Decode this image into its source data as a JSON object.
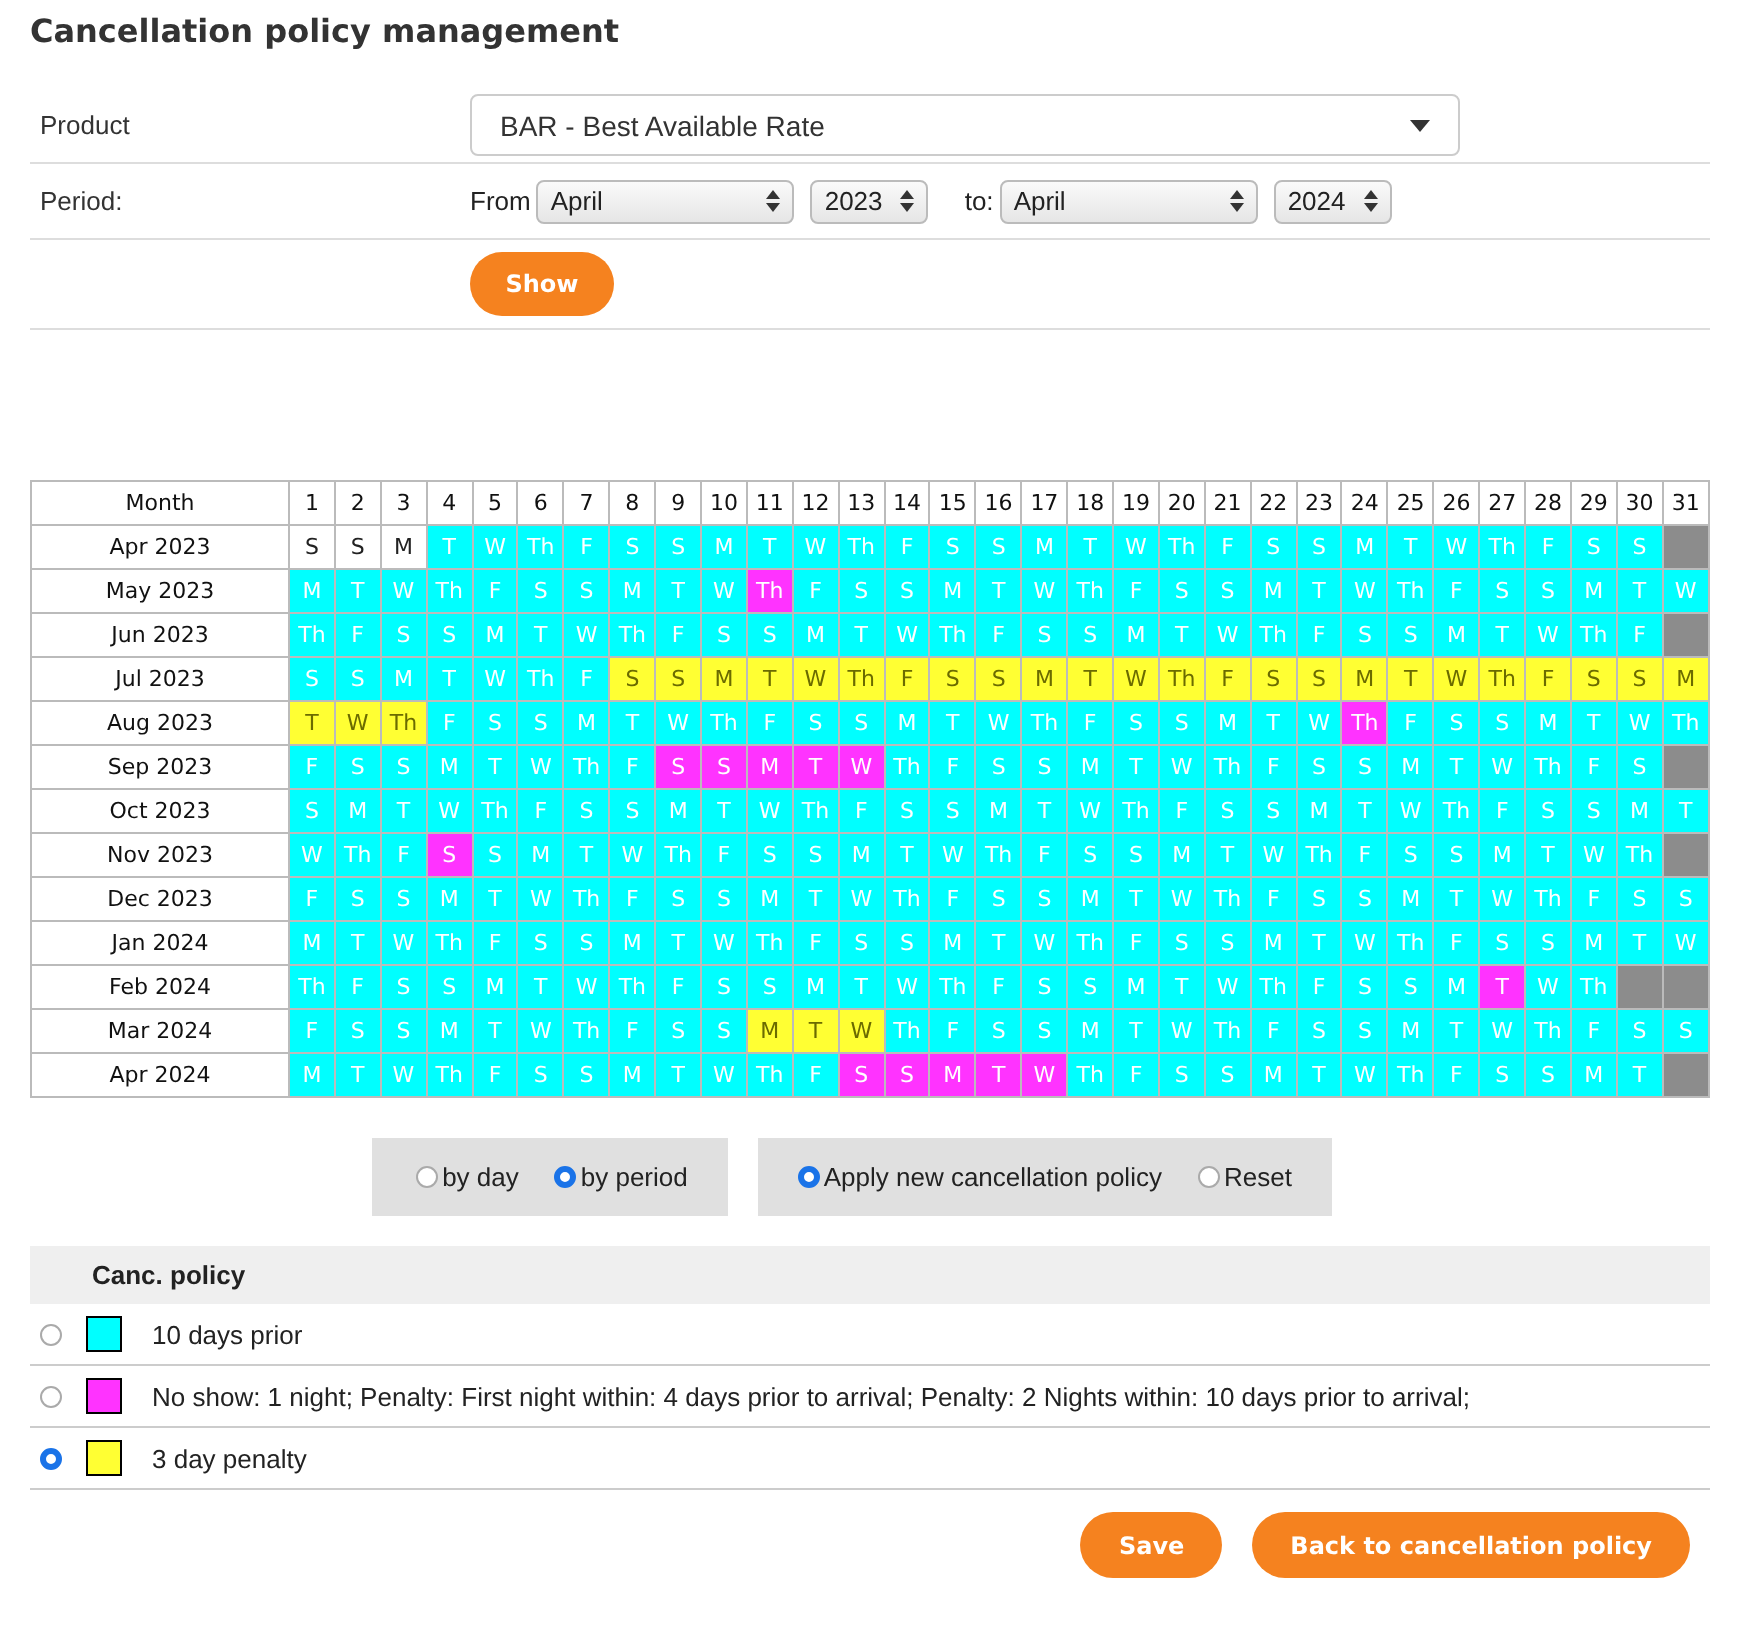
{
  "page_title": "Cancellation policy management",
  "form": {
    "product": {
      "label": "Product",
      "value": "BAR - Best Available Rate"
    },
    "period": {
      "label": "Period:",
      "from_label": "From",
      "from_month": "April",
      "from_year": "2023",
      "to_label": "to:",
      "to_month": "April",
      "to_year": "2024"
    },
    "show_button": "Show"
  },
  "calendar": {
    "month_header": "Month",
    "day_numbers": [
      "1",
      "2",
      "3",
      "4",
      "5",
      "6",
      "7",
      "8",
      "9",
      "10",
      "11",
      "12",
      "13",
      "14",
      "15",
      "16",
      "17",
      "18",
      "19",
      "20",
      "21",
      "22",
      "23",
      "24",
      "25",
      "26",
      "27",
      "28",
      "29",
      "30",
      "31"
    ],
    "rows": [
      {
        "month": "Apr 2023",
        "days": [
          {
            "day": "S",
            "color": "#ffffff"
          },
          {
            "day": "S",
            "color": "#ffffff"
          },
          {
            "day": "M",
            "color": "#ffffff"
          },
          {
            "day": "T",
            "color": "#00ffff"
          },
          {
            "day": "W",
            "color": "#00ffff"
          },
          {
            "day": "Th",
            "color": "#00ffff"
          },
          {
            "day": "F",
            "color": "#00ffff"
          },
          {
            "day": "S",
            "color": "#00ffff"
          },
          {
            "day": "S",
            "color": "#00ffff"
          },
          {
            "day": "M",
            "color": "#00ffff"
          },
          {
            "day": "T",
            "color": "#00ffff"
          },
          {
            "day": "W",
            "color": "#00ffff"
          },
          {
            "day": "Th",
            "color": "#00ffff"
          },
          {
            "day": "F",
            "color": "#00ffff"
          },
          {
            "day": "S",
            "color": "#00ffff"
          },
          {
            "day": "S",
            "color": "#00ffff"
          },
          {
            "day": "M",
            "color": "#00ffff"
          },
          {
            "day": "T",
            "color": "#00ffff"
          },
          {
            "day": "W",
            "color": "#00ffff"
          },
          {
            "day": "Th",
            "color": "#00ffff"
          },
          {
            "day": "F",
            "color": "#00ffff"
          },
          {
            "day": "S",
            "color": "#00ffff"
          },
          {
            "day": "S",
            "color": "#00ffff"
          },
          {
            "day": "M",
            "color": "#00ffff"
          },
          {
            "day": "T",
            "color": "#00ffff"
          },
          {
            "day": "W",
            "color": "#00ffff"
          },
          {
            "day": "Th",
            "color": "#00ffff"
          },
          {
            "day": "F",
            "color": "#00ffff"
          },
          {
            "day": "S",
            "color": "#00ffff"
          },
          {
            "day": "S",
            "color": "#00ffff"
          },
          {
            "color": "#8c8c8c"
          }
        ]
      },
      {
        "month": "May 2023",
        "days": [
          {
            "day": "M",
            "color": "#00ffff"
          },
          {
            "day": "T",
            "color": "#00ffff"
          },
          {
            "day": "W",
            "color": "#00ffff"
          },
          {
            "day": "Th",
            "color": "#00ffff"
          },
          {
            "day": "F",
            "color": "#00ffff"
          },
          {
            "day": "S",
            "color": "#00ffff"
          },
          {
            "day": "S",
            "color": "#00ffff"
          },
          {
            "day": "M",
            "color": "#00ffff"
          },
          {
            "day": "T",
            "color": "#00ffff"
          },
          {
            "day": "W",
            "color": "#00ffff"
          },
          {
            "day": "Th",
            "color": "#ff33ff"
          },
          {
            "day": "F",
            "color": "#00ffff"
          },
          {
            "day": "S",
            "color": "#00ffff"
          },
          {
            "day": "S",
            "color": "#00ffff"
          },
          {
            "day": "M",
            "color": "#00ffff"
          },
          {
            "day": "T",
            "color": "#00ffff"
          },
          {
            "day": "W",
            "color": "#00ffff"
          },
          {
            "day": "Th",
            "color": "#00ffff"
          },
          {
            "day": "F",
            "color": "#00ffff"
          },
          {
            "day": "S",
            "color": "#00ffff"
          },
          {
            "day": "S",
            "color": "#00ffff"
          },
          {
            "day": "M",
            "color": "#00ffff"
          },
          {
            "day": "T",
            "color": "#00ffff"
          },
          {
            "day": "W",
            "color": "#00ffff"
          },
          {
            "day": "Th",
            "color": "#00ffff"
          },
          {
            "day": "F",
            "color": "#00ffff"
          },
          {
            "day": "S",
            "color": "#00ffff"
          },
          {
            "day": "S",
            "color": "#00ffff"
          },
          {
            "day": "M",
            "color": "#00ffff"
          },
          {
            "day": "T",
            "color": "#00ffff"
          },
          {
            "day": "W",
            "color": "#00ffff"
          }
        ]
      },
      {
        "month": "Jun 2023",
        "days": [
          {
            "day": "Th",
            "color": "#00ffff"
          },
          {
            "day": "F",
            "color": "#00ffff"
          },
          {
            "day": "S",
            "color": "#00ffff"
          },
          {
            "day": "S",
            "color": "#00ffff"
          },
          {
            "day": "M",
            "color": "#00ffff"
          },
          {
            "day": "T",
            "color": "#00ffff"
          },
          {
            "day": "W",
            "color": "#00ffff"
          },
          {
            "day": "Th",
            "color": "#00ffff"
          },
          {
            "day": "F",
            "color": "#00ffff"
          },
          {
            "day": "S",
            "color": "#00ffff"
          },
          {
            "day": "S",
            "color": "#00ffff"
          },
          {
            "day": "M",
            "color": "#00ffff"
          },
          {
            "day": "T",
            "color": "#00ffff"
          },
          {
            "day": "W",
            "color": "#00ffff"
          },
          {
            "day": "Th",
            "color": "#00ffff"
          },
          {
            "day": "F",
            "color": "#00ffff"
          },
          {
            "day": "S",
            "color": "#00ffff"
          },
          {
            "day": "S",
            "color": "#00ffff"
          },
          {
            "day": "M",
            "color": "#00ffff"
          },
          {
            "day": "T",
            "color": "#00ffff"
          },
          {
            "day": "W",
            "color": "#00ffff"
          },
          {
            "day": "Th",
            "color": "#00ffff"
          },
          {
            "day": "F",
            "color": "#00ffff"
          },
          {
            "day": "S",
            "color": "#00ffff"
          },
          {
            "day": "S",
            "color": "#00ffff"
          },
          {
            "day": "M",
            "color": "#00ffff"
          },
          {
            "day": "T",
            "color": "#00ffff"
          },
          {
            "day": "W",
            "color": "#00ffff"
          },
          {
            "day": "Th",
            "color": "#00ffff"
          },
          {
            "day": "F",
            "color": "#00ffff"
          },
          {
            "color": "#8c8c8c"
          }
        ]
      },
      {
        "month": "Jul 2023",
        "days": [
          {
            "day": "S",
            "color": "#00ffff"
          },
          {
            "day": "S",
            "color": "#00ffff"
          },
          {
            "day": "M",
            "color": "#00ffff"
          },
          {
            "day": "T",
            "color": "#00ffff"
          },
          {
            "day": "W",
            "color": "#00ffff"
          },
          {
            "day": "Th",
            "color": "#00ffff"
          },
          {
            "day": "F",
            "color": "#00ffff"
          },
          {
            "day": "S",
            "color": "#ffff33"
          },
          {
            "day": "S",
            "color": "#ffff33"
          },
          {
            "day": "M",
            "color": "#ffff33"
          },
          {
            "day": "T",
            "color": "#ffff33"
          },
          {
            "day": "W",
            "color": "#ffff33"
          },
          {
            "day": "Th",
            "color": "#ffff33"
          },
          {
            "day": "F",
            "color": "#ffff33"
          },
          {
            "day": "S",
            "color": "#ffff33"
          },
          {
            "day": "S",
            "color": "#ffff33"
          },
          {
            "day": "M",
            "color": "#ffff33"
          },
          {
            "day": "T",
            "color": "#ffff33"
          },
          {
            "day": "W",
            "color": "#ffff33"
          },
          {
            "day": "Th",
            "color": "#ffff33"
          },
          {
            "day": "F",
            "color": "#ffff33"
          },
          {
            "day": "S",
            "color": "#ffff33"
          },
          {
            "day": "S",
            "color": "#ffff33"
          },
          {
            "day": "M",
            "color": "#ffff33"
          },
          {
            "day": "T",
            "color": "#ffff33"
          },
          {
            "day": "W",
            "color": "#ffff33"
          },
          {
            "day": "Th",
            "color": "#ffff33"
          },
          {
            "day": "F",
            "color": "#ffff33"
          },
          {
            "day": "S",
            "color": "#ffff33"
          },
          {
            "day": "S",
            "color": "#ffff33"
          },
          {
            "day": "M",
            "color": "#ffff33"
          }
        ]
      },
      {
        "month": "Aug 2023",
        "days": [
          {
            "day": "T",
            "color": "#ffff33"
          },
          {
            "day": "W",
            "color": "#ffff33"
          },
          {
            "day": "Th",
            "color": "#ffff33"
          },
          {
            "day": "F",
            "color": "#00ffff"
          },
          {
            "day": "S",
            "color": "#00ffff"
          },
          {
            "day": "S",
            "color": "#00ffff"
          },
          {
            "day": "M",
            "color": "#00ffff"
          },
          {
            "day": "T",
            "color": "#00ffff"
          },
          {
            "day": "W",
            "color": "#00ffff"
          },
          {
            "day": "Th",
            "color": "#00ffff"
          },
          {
            "day": "F",
            "color": "#00ffff"
          },
          {
            "day": "S",
            "color": "#00ffff"
          },
          {
            "day": "S",
            "color": "#00ffff"
          },
          {
            "day": "M",
            "color": "#00ffff"
          },
          {
            "day": "T",
            "color": "#00ffff"
          },
          {
            "day": "W",
            "color": "#00ffff"
          },
          {
            "day": "Th",
            "color": "#00ffff"
          },
          {
            "day": "F",
            "color": "#00ffff"
          },
          {
            "day": "S",
            "color": "#00ffff"
          },
          {
            "day": "S",
            "color": "#00ffff"
          },
          {
            "day": "M",
            "color": "#00ffff"
          },
          {
            "day": "T",
            "color": "#00ffff"
          },
          {
            "day": "W",
            "color": "#00ffff"
          },
          {
            "day": "Th",
            "color": "#ff33ff"
          },
          {
            "day": "F",
            "color": "#00ffff"
          },
          {
            "day": "S",
            "color": "#00ffff"
          },
          {
            "day": "S",
            "color": "#00ffff"
          },
          {
            "day": "M",
            "color": "#00ffff"
          },
          {
            "day": "T",
            "color": "#00ffff"
          },
          {
            "day": "W",
            "color": "#00ffff"
          },
          {
            "day": "Th",
            "color": "#00ffff"
          }
        ]
      },
      {
        "month": "Sep 2023",
        "days": [
          {
            "day": "F",
            "color": "#00ffff"
          },
          {
            "day": "S",
            "color": "#00ffff"
          },
          {
            "day": "S",
            "color": "#00ffff"
          },
          {
            "day": "M",
            "color": "#00ffff"
          },
          {
            "day": "T",
            "color": "#00ffff"
          },
          {
            "day": "W",
            "color": "#00ffff"
          },
          {
            "day": "Th",
            "color": "#00ffff"
          },
          {
            "day": "F",
            "color": "#00ffff"
          },
          {
            "day": "S",
            "color": "#ff33ff"
          },
          {
            "day": "S",
            "color": "#ff33ff"
          },
          {
            "day": "M",
            "color": "#ff33ff"
          },
          {
            "day": "T",
            "color": "#ff33ff"
          },
          {
            "day": "W",
            "color": "#ff33ff"
          },
          {
            "day": "Th",
            "color": "#00ffff"
          },
          {
            "day": "F",
            "color": "#00ffff"
          },
          {
            "day": "S",
            "color": "#00ffff"
          },
          {
            "day": "S",
            "color": "#00ffff"
          },
          {
            "day": "M",
            "color": "#00ffff"
          },
          {
            "day": "T",
            "color": "#00ffff"
          },
          {
            "day": "W",
            "color": "#00ffff"
          },
          {
            "day": "Th",
            "color": "#00ffff"
          },
          {
            "day": "F",
            "color": "#00ffff"
          },
          {
            "day": "S",
            "color": "#00ffff"
          },
          {
            "day": "S",
            "color": "#00ffff"
          },
          {
            "day": "M",
            "color": "#00ffff"
          },
          {
            "day": "T",
            "color": "#00ffff"
          },
          {
            "day": "W",
            "color": "#00ffff"
          },
          {
            "day": "Th",
            "color": "#00ffff"
          },
          {
            "day": "F",
            "color": "#00ffff"
          },
          {
            "day": "S",
            "color": "#00ffff"
          },
          {
            "color": "#8c8c8c"
          }
        ]
      },
      {
        "month": "Oct 2023",
        "days": [
          {
            "day": "S",
            "color": "#00ffff"
          },
          {
            "day": "M",
            "color": "#00ffff"
          },
          {
            "day": "T",
            "color": "#00ffff"
          },
          {
            "day": "W",
            "color": "#00ffff"
          },
          {
            "day": "Th",
            "color": "#00ffff"
          },
          {
            "day": "F",
            "color": "#00ffff"
          },
          {
            "day": "S",
            "color": "#00ffff"
          },
          {
            "day": "S",
            "color": "#00ffff"
          },
          {
            "day": "M",
            "color": "#00ffff"
          },
          {
            "day": "T",
            "color": "#00ffff"
          },
          {
            "day": "W",
            "color": "#00ffff"
          },
          {
            "day": "Th",
            "color": "#00ffff"
          },
          {
            "day": "F",
            "color": "#00ffff"
          },
          {
            "day": "S",
            "color": "#00ffff"
          },
          {
            "day": "S",
            "color": "#00ffff"
          },
          {
            "day": "M",
            "color": "#00ffff"
          },
          {
            "day": "T",
            "color": "#00ffff"
          },
          {
            "day": "W",
            "color": "#00ffff"
          },
          {
            "day": "Th",
            "color": "#00ffff"
          },
          {
            "day": "F",
            "color": "#00ffff"
          },
          {
            "day": "S",
            "color": "#00ffff"
          },
          {
            "day": "S",
            "color": "#00ffff"
          },
          {
            "day": "M",
            "color": "#00ffff"
          },
          {
            "day": "T",
            "color": "#00ffff"
          },
          {
            "day": "W",
            "color": "#00ffff"
          },
          {
            "day": "Th",
            "color": "#00ffff"
          },
          {
            "day": "F",
            "color": "#00ffff"
          },
          {
            "day": "S",
            "color": "#00ffff"
          },
          {
            "day": "S",
            "color": "#00ffff"
          },
          {
            "day": "M",
            "color": "#00ffff"
          },
          {
            "day": "T",
            "color": "#00ffff"
          }
        ]
      },
      {
        "month": "Nov 2023",
        "days": [
          {
            "day": "W",
            "color": "#00ffff"
          },
          {
            "day": "Th",
            "color": "#00ffff"
          },
          {
            "day": "F",
            "color": "#00ffff"
          },
          {
            "day": "S",
            "color": "#ff33ff"
          },
          {
            "day": "S",
            "color": "#00ffff"
          },
          {
            "day": "M",
            "color": "#00ffff"
          },
          {
            "day": "T",
            "color": "#00ffff"
          },
          {
            "day": "W",
            "color": "#00ffff"
          },
          {
            "day": "Th",
            "color": "#00ffff"
          },
          {
            "day": "F",
            "color": "#00ffff"
          },
          {
            "day": "S",
            "color": "#00ffff"
          },
          {
            "day": "S",
            "color": "#00ffff"
          },
          {
            "day": "M",
            "color": "#00ffff"
          },
          {
            "day": "T",
            "color": "#00ffff"
          },
          {
            "day": "W",
            "color": "#00ffff"
          },
          {
            "day": "Th",
            "color": "#00ffff"
          },
          {
            "day": "F",
            "color": "#00ffff"
          },
          {
            "day": "S",
            "color": "#00ffff"
          },
          {
            "day": "S",
            "color": "#00ffff"
          },
          {
            "day": "M",
            "color": "#00ffff"
          },
          {
            "day": "T",
            "color": "#00ffff"
          },
          {
            "day": "W",
            "color": "#00ffff"
          },
          {
            "day": "Th",
            "color": "#00ffff"
          },
          {
            "day": "F",
            "color": "#00ffff"
          },
          {
            "day": "S",
            "color": "#00ffff"
          },
          {
            "day": "S",
            "color": "#00ffff"
          },
          {
            "day": "M",
            "color": "#00ffff"
          },
          {
            "day": "T",
            "color": "#00ffff"
          },
          {
            "day": "W",
            "color": "#00ffff"
          },
          {
            "day": "Th",
            "color": "#00ffff"
          },
          {
            "color": "#8c8c8c"
          }
        ]
      },
      {
        "month": "Dec 2023",
        "days": [
          {
            "day": "F",
            "color": "#00ffff"
          },
          {
            "day": "S",
            "color": "#00ffff"
          },
          {
            "day": "S",
            "color": "#00ffff"
          },
          {
            "day": "M",
            "color": "#00ffff"
          },
          {
            "day": "T",
            "color": "#00ffff"
          },
          {
            "day": "W",
            "color": "#00ffff"
          },
          {
            "day": "Th",
            "color": "#00ffff"
          },
          {
            "day": "F",
            "color": "#00ffff"
          },
          {
            "day": "S",
            "color": "#00ffff"
          },
          {
            "day": "S",
            "color": "#00ffff"
          },
          {
            "day": "M",
            "color": "#00ffff"
          },
          {
            "day": "T",
            "color": "#00ffff"
          },
          {
            "day": "W",
            "color": "#00ffff"
          },
          {
            "day": "Th",
            "color": "#00ffff"
          },
          {
            "day": "F",
            "color": "#00ffff"
          },
          {
            "day": "S",
            "color": "#00ffff"
          },
          {
            "day": "S",
            "color": "#00ffff"
          },
          {
            "day": "M",
            "color": "#00ffff"
          },
          {
            "day": "T",
            "color": "#00ffff"
          },
          {
            "day": "W",
            "color": "#00ffff"
          },
          {
            "day": "Th",
            "color": "#00ffff"
          },
          {
            "day": "F",
            "color": "#00ffff"
          },
          {
            "day": "S",
            "color": "#00ffff"
          },
          {
            "day": "S",
            "color": "#00ffff"
          },
          {
            "day": "M",
            "color": "#00ffff"
          },
          {
            "day": "T",
            "color": "#00ffff"
          },
          {
            "day": "W",
            "color": "#00ffff"
          },
          {
            "day": "Th",
            "color": "#00ffff"
          },
          {
            "day": "F",
            "color": "#00ffff"
          },
          {
            "day": "S",
            "color": "#00ffff"
          },
          {
            "day": "S",
            "color": "#00ffff"
          }
        ]
      },
      {
        "month": "Jan 2024",
        "days": [
          {
            "day": "M",
            "color": "#00ffff"
          },
          {
            "day": "T",
            "color": "#00ffff"
          },
          {
            "day": "W",
            "color": "#00ffff"
          },
          {
            "day": "Th",
            "color": "#00ffff"
          },
          {
            "day": "F",
            "color": "#00ffff"
          },
          {
            "day": "S",
            "color": "#00ffff"
          },
          {
            "day": "S",
            "color": "#00ffff"
          },
          {
            "day": "M",
            "color": "#00ffff"
          },
          {
            "day": "T",
            "color": "#00ffff"
          },
          {
            "day": "W",
            "color": "#00ffff"
          },
          {
            "day": "Th",
            "color": "#00ffff"
          },
          {
            "day": "F",
            "color": "#00ffff"
          },
          {
            "day": "S",
            "color": "#00ffff"
          },
          {
            "day": "S",
            "color": "#00ffff"
          },
          {
            "day": "M",
            "color": "#00ffff"
          },
          {
            "day": "T",
            "color": "#00ffff"
          },
          {
            "day": "W",
            "color": "#00ffff"
          },
          {
            "day": "Th",
            "color": "#00ffff"
          },
          {
            "day": "F",
            "color": "#00ffff"
          },
          {
            "day": "S",
            "color": "#00ffff"
          },
          {
            "day": "S",
            "color": "#00ffff"
          },
          {
            "day": "M",
            "color": "#00ffff"
          },
          {
            "day": "T",
            "color": "#00ffff"
          },
          {
            "day": "W",
            "color": "#00ffff"
          },
          {
            "day": "Th",
            "color": "#00ffff"
          },
          {
            "day": "F",
            "color": "#00ffff"
          },
          {
            "day": "S",
            "color": "#00ffff"
          },
          {
            "day": "S",
            "color": "#00ffff"
          },
          {
            "day": "M",
            "color": "#00ffff"
          },
          {
            "day": "T",
            "color": "#00ffff"
          },
          {
            "day": "W",
            "color": "#00ffff"
          }
        ]
      },
      {
        "month": "Feb 2024",
        "days": [
          {
            "day": "Th",
            "color": "#00ffff"
          },
          {
            "day": "F",
            "color": "#00ffff"
          },
          {
            "day": "S",
            "color": "#00ffff"
          },
          {
            "day": "S",
            "color": "#00ffff"
          },
          {
            "day": "M",
            "color": "#00ffff"
          },
          {
            "day": "T",
            "color": "#00ffff"
          },
          {
            "day": "W",
            "color": "#00ffff"
          },
          {
            "day": "Th",
            "color": "#00ffff"
          },
          {
            "day": "F",
            "color": "#00ffff"
          },
          {
            "day": "S",
            "color": "#00ffff"
          },
          {
            "day": "S",
            "color": "#00ffff"
          },
          {
            "day": "M",
            "color": "#00ffff"
          },
          {
            "day": "T",
            "color": "#00ffff"
          },
          {
            "day": "W",
            "color": "#00ffff"
          },
          {
            "day": "Th",
            "color": "#00ffff"
          },
          {
            "day": "F",
            "color": "#00ffff"
          },
          {
            "day": "S",
            "color": "#00ffff"
          },
          {
            "day": "S",
            "color": "#00ffff"
          },
          {
            "day": "M",
            "color": "#00ffff"
          },
          {
            "day": "T",
            "color": "#00ffff"
          },
          {
            "day": "W",
            "color": "#00ffff"
          },
          {
            "day": "Th",
            "color": "#00ffff"
          },
          {
            "day": "F",
            "color": "#00ffff"
          },
          {
            "day": "S",
            "color": "#00ffff"
          },
          {
            "day": "S",
            "color": "#00ffff"
          },
          {
            "day": "M",
            "color": "#00ffff"
          },
          {
            "day": "T",
            "color": "#ff33ff"
          },
          {
            "day": "W",
            "color": "#00ffff"
          },
          {
            "day": "Th",
            "color": "#00ffff"
          },
          {
            "color": "#8c8c8c"
          },
          {
            "color": "#8c8c8c"
          }
        ]
      },
      {
        "month": "Mar 2024",
        "days": [
          {
            "day": "F",
            "color": "#00ffff"
          },
          {
            "day": "S",
            "color": "#00ffff"
          },
          {
            "day": "S",
            "color": "#00ffff"
          },
          {
            "day": "M",
            "color": "#00ffff"
          },
          {
            "day": "T",
            "color": "#00ffff"
          },
          {
            "day": "W",
            "color": "#00ffff"
          },
          {
            "day": "Th",
            "color": "#00ffff"
          },
          {
            "day": "F",
            "color": "#00ffff"
          },
          {
            "day": "S",
            "color": "#00ffff"
          },
          {
            "day": "S",
            "color": "#00ffff"
          },
          {
            "day": "M",
            "color": "#ffff33"
          },
          {
            "day": "T",
            "color": "#ffff33"
          },
          {
            "day": "W",
            "color": "#ffff33"
          },
          {
            "day": "Th",
            "color": "#00ffff"
          },
          {
            "day": "F",
            "color": "#00ffff"
          },
          {
            "day": "S",
            "color": "#00ffff"
          },
          {
            "day": "S",
            "color": "#00ffff"
          },
          {
            "day": "M",
            "color": "#00ffff"
          },
          {
            "day": "T",
            "color": "#00ffff"
          },
          {
            "day": "W",
            "color": "#00ffff"
          },
          {
            "day": "Th",
            "color": "#00ffff"
          },
          {
            "day": "F",
            "color": "#00ffff"
          },
          {
            "day": "S",
            "color": "#00ffff"
          },
          {
            "day": "S",
            "color": "#00ffff"
          },
          {
            "day": "M",
            "color": "#00ffff"
          },
          {
            "day": "T",
            "color": "#00ffff"
          },
          {
            "day": "W",
            "color": "#00ffff"
          },
          {
            "day": "Th",
            "color": "#00ffff"
          },
          {
            "day": "F",
            "color": "#00ffff"
          },
          {
            "day": "S",
            "color": "#00ffff"
          },
          {
            "day": "S",
            "color": "#00ffff"
          }
        ]
      },
      {
        "month": "Apr 2024",
        "days": [
          {
            "day": "M",
            "color": "#00ffff"
          },
          {
            "day": "T",
            "color": "#00ffff"
          },
          {
            "day": "W",
            "color": "#00ffff"
          },
          {
            "day": "Th",
            "color": "#00ffff"
          },
          {
            "day": "F",
            "color": "#00ffff"
          },
          {
            "day": "S",
            "color": "#00ffff"
          },
          {
            "day": "S",
            "color": "#00ffff"
          },
          {
            "day": "M",
            "color": "#00ffff"
          },
          {
            "day": "T",
            "color": "#00ffff"
          },
          {
            "day": "W",
            "color": "#00ffff"
          },
          {
            "day": "Th",
            "color": "#00ffff"
          },
          {
            "day": "F",
            "color": "#00ffff"
          },
          {
            "day": "S",
            "color": "#ff33ff"
          },
          {
            "day": "S",
            "color": "#ff33ff"
          },
          {
            "day": "M",
            "color": "#ff33ff"
          },
          {
            "day": "T",
            "color": "#ff33ff"
          },
          {
            "day": "W",
            "color": "#ff33ff"
          },
          {
            "day": "Th",
            "color": "#00ffff"
          },
          {
            "day": "F",
            "color": "#00ffff"
          },
          {
            "day": "S",
            "color": "#00ffff"
          },
          {
            "day": "S",
            "color": "#00ffff"
          },
          {
            "day": "M",
            "color": "#00ffff"
          },
          {
            "day": "T",
            "color": "#00ffff"
          },
          {
            "day": "W",
            "color": "#00ffff"
          },
          {
            "day": "Th",
            "color": "#00ffff"
          },
          {
            "day": "F",
            "color": "#00ffff"
          },
          {
            "day": "S",
            "color": "#00ffff"
          },
          {
            "day": "S",
            "color": "#00ffff"
          },
          {
            "day": "M",
            "color": "#00ffff"
          },
          {
            "day": "T",
            "color": "#00ffff"
          },
          {
            "color": "#8c8c8c"
          }
        ]
      }
    ]
  },
  "mode_options": [
    {
      "label": "by day",
      "selected": false
    },
    {
      "label": "by period",
      "selected": true
    }
  ],
  "action_options": [
    {
      "label": "Apply new cancellation policy",
      "selected": true
    },
    {
      "label": "Reset",
      "selected": false
    }
  ],
  "policy_table": {
    "header": "Canc. policy",
    "policies": [
      {
        "label": "10 days prior",
        "color": "#00ffff",
        "selected": false
      },
      {
        "label": "No show: 1 night; Penalty: First night within: 4 days prior to arrival; Penalty: 2 Nights within: 10 days prior to arrival;",
        "color": "#ff33ff",
        "selected": false
      },
      {
        "label": "3 day penalty",
        "color": "#ffff33",
        "selected": true
      }
    ]
  },
  "buttons": [
    {
      "label": "Save"
    },
    {
      "label": "Back to cancellation policy"
    }
  ]
}
